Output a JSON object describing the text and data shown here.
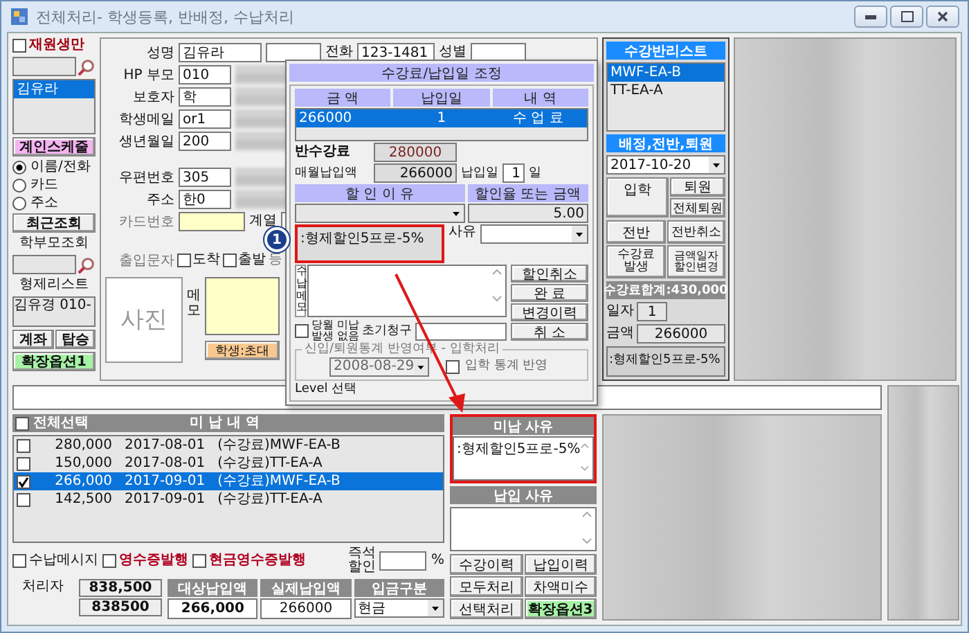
{
  "window": {
    "title": "전체처리- 학생등록, 반배정, 수납처리"
  },
  "left_panel": {
    "enrolled_only": {
      "label": "재원생만",
      "checked": false
    },
    "students": [
      {
        "name": "김유라",
        "selected": true
      }
    ],
    "schedule_button": "계인스케줄",
    "search_modes": [
      {
        "label": "이름/전화",
        "selected": true
      },
      {
        "label": "카드",
        "selected": false
      },
      {
        "label": "주소",
        "selected": false
      }
    ],
    "recent_button": "최근조회",
    "parent_search_label": "학부모조회",
    "sibling_list_label": "형제리스트",
    "siblings": [
      "김유경 010-"
    ],
    "buttons": [
      "계좌",
      "탑승"
    ],
    "option_button": "확장옵션1"
  },
  "student_form": {
    "fields": [
      {
        "label": "성명",
        "value": "김유라"
      },
      {
        "label": "HP 부모",
        "value": "010"
      },
      {
        "label": "보호자",
        "value": "학"
      },
      {
        "label": "학생메일",
        "value": "or1"
      },
      {
        "label": "생년월일",
        "value": "200"
      }
    ],
    "phone_label": "전화",
    "phone_value": "123-1481",
    "gender_label": "성별",
    "address_fields": [
      {
        "label": "우편번호",
        "value": "305"
      },
      {
        "label": "주소",
        "value": "한0"
      }
    ],
    "card_label": "카드번호",
    "series_label": "계열",
    "entry_sms_label": "출입문자",
    "entry_sms_options": [
      {
        "label": "도착",
        "checked": false
      },
      {
        "label": "출발",
        "checked": false
      }
    ],
    "entry_sms_more": "등",
    "photo_label": "사진",
    "memo_label": "메모",
    "student_type_button": "학생:초대"
  },
  "class_panel": {
    "title": "수강반리스트",
    "classes": [
      {
        "name": "MWF-EA-B",
        "selected": true
      },
      {
        "name": "TT-EA-A",
        "selected": false
      }
    ],
    "assign_title": "배정,전반,퇴원",
    "date": "2017-10-20",
    "buttons": [
      "입학",
      "퇴원",
      "전체퇴원",
      "전반",
      "전반취소",
      "수강료\n발생",
      "금액일자\n할인변경"
    ],
    "total": "수강료합계:430,000",
    "day_label": "일자",
    "day_value": "1",
    "amount_label": "금액",
    "amount_value": "266000",
    "note": ":형제할인5프로-5%"
  },
  "dialog": {
    "title": "수강료/납입일 조정",
    "columns": [
      "금 액",
      "납입일",
      "내 역"
    ],
    "rows": [
      {
        "cells": [
          "266000",
          "1",
          "수 업 료"
        ],
        "selected": true
      }
    ],
    "base_fee_label": "반수강료",
    "base_fee": "280000",
    "monthly_label": "매월납입액",
    "monthly_amount": "266000",
    "pay_day_label": "납입일",
    "pay_day": "1",
    "pay_day_unit": "일",
    "discount_headers": [
      "할 인 이 유",
      "할인율 또는 금액"
    ],
    "discount_value": "5.00",
    "discount_reason": ":형제할인5프로-5%",
    "reason_label": "사유",
    "memo_label": "수납메모",
    "buttons": [
      "할인취소",
      "완 료",
      "변경이력",
      "취 소"
    ],
    "no_unpaid": {
      "label": "당월 미납\n발생 없음",
      "checked": false
    },
    "initial_charge_label": "초기청구",
    "stats_group": {
      "legend": "신입/퇴원통계 반영여부 - 입학처리",
      "date": "2008-08-29",
      "reflect": {
        "label": "입학 통계 반영",
        "checked": false
      }
    },
    "level_label": "Level 선택"
  },
  "callout": "1",
  "bottom": {
    "unpaid_list": {
      "select_all": {
        "label": "전체선택",
        "checked": false
      },
      "title": "미 납 내 역",
      "rows": [
        {
          "amount": "280,000",
          "date": "2017-08-01",
          "item": "(수강료)MWF-EA-B",
          "checked": false,
          "selected": false
        },
        {
          "amount": "150,000",
          "date": "2017-08-01",
          "item": "(수강료)TT-EA-A",
          "checked": false,
          "selected": false
        },
        {
          "amount": "266,000",
          "date": "2017-09-01",
          "item": "(수강료)MWF-EA-B",
          "checked": true,
          "selected": true
        },
        {
          "amount": "142,500",
          "date": "2017-09-01",
          "item": "(수강료)TT-EA-A",
          "checked": false,
          "selected": false
        }
      ]
    },
    "options": [
      {
        "label": "수납메시지",
        "checked": false,
        "kind": "plain"
      },
      {
        "label": "영수증발행",
        "checked": false,
        "kind": "alert"
      },
      {
        "label": "현금영수증발행",
        "checked": false,
        "kind": "alert"
      }
    ],
    "instant_discount_label": "즉석\n할인",
    "percent": "%",
    "handler_label": "처리자",
    "totals": [
      "838,500",
      "838500"
    ],
    "payment_columns": [
      "대상납입액",
      "실제납입액",
      "입금구분"
    ],
    "target_amount": "266,000",
    "actual_amount": "266000",
    "payment_type": "현금",
    "unpaid_reason_title": "미납 사유",
    "unpaid_reason": ":형제할인5프로-5%",
    "paid_reason_title": "납입 사유",
    "action_buttons": [
      {
        "label": "수강이력",
        "kind": "normal"
      },
      {
        "label": "납입이력",
        "kind": "normal"
      },
      {
        "label": "모두처리",
        "kind": "normal"
      },
      {
        "label": "차액미수",
        "kind": "normal"
      },
      {
        "label": "선택처리",
        "kind": "normal"
      },
      {
        "label": "확장옵션3",
        "kind": "option"
      }
    ]
  }
}
